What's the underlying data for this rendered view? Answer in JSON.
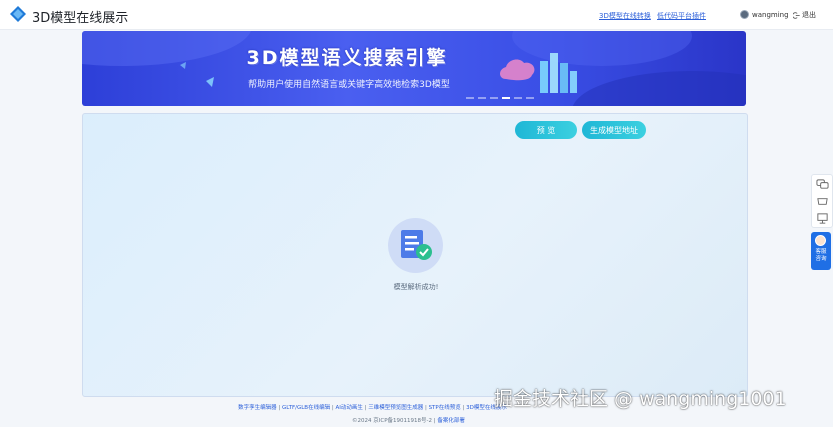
{
  "header": {
    "app_title": "3D模型在线展示",
    "nav_links": [
      "3D模型在线转换",
      "低代码平台插件"
    ],
    "username": "wangming",
    "logout_label": "退出"
  },
  "banner": {
    "title": "3D模型语义搜索引擎",
    "subtitle": "帮助用户使用自然语言或关键字高效地检索3D模型"
  },
  "panel": {
    "preview_label": "预 览",
    "generate_label": "生成模型地址",
    "status_text": "模型解析成功!"
  },
  "side_service": {
    "label_line1": "客服",
    "label_line2": "咨询"
  },
  "footer": {
    "links": [
      "数字孪生编辑器",
      "GLTF/GLB在线编辑",
      "AI动动画生",
      "三维模型预览图生成器",
      "STP在线预览",
      "3D模型在线展示"
    ],
    "copyright": "©2024 京ICP备19011918号-2",
    "extra_link": "备案化部署"
  },
  "watermark": "掘金技术社区 @ wangming1001",
  "colors": {
    "accent_blue": "#2b5fd9",
    "banner_blue": "#3a4fe6",
    "button_cyan": "#1fb7d6",
    "success_green": "#2bbf8f"
  }
}
